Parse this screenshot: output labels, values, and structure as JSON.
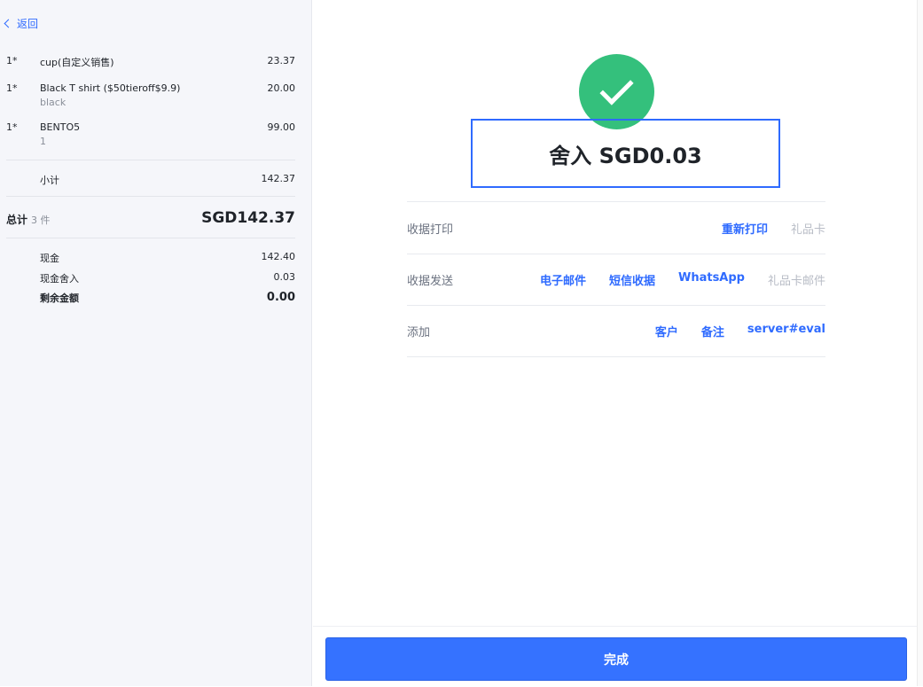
{
  "sidebar": {
    "back_label": "返回",
    "items": [
      {
        "qty": "1*",
        "name": "cup(自定义销售)",
        "sub": "",
        "price": "23.37"
      },
      {
        "qty": "1*",
        "name": "Black T shirt ($50tieroff$9.9)",
        "sub": "black",
        "price": "20.00"
      },
      {
        "qty": "1*",
        "name": "BENTO5",
        "sub": "1",
        "price": "99.00"
      }
    ],
    "subtotal_label": "小计",
    "subtotal_value": "142.37",
    "total_label": "总计",
    "total_count": "3 件",
    "total_value": "SGD142.37",
    "payments": [
      {
        "label": "现金",
        "value": "142.40"
      },
      {
        "label": "现金舍入",
        "value": "0.03"
      },
      {
        "label": "剩余金额",
        "value": "0.00"
      }
    ]
  },
  "main": {
    "title": "舍入 SGD0.03",
    "print_label": "收据打印",
    "reprint": "重新打印",
    "gift_card": "礼品卡",
    "send_label": "收据发送",
    "email": "电子邮件",
    "sms": "短信收据",
    "whatsapp": "WhatsApp",
    "gift_card_email": "礼品卡邮件",
    "add_label": "添加",
    "customer": "客户",
    "note": "备注",
    "server": "server#eval",
    "done": "完成"
  },
  "colors": {
    "accent": "#2f6bff",
    "success": "#34c07c",
    "disabled": "#b8bcc6"
  }
}
